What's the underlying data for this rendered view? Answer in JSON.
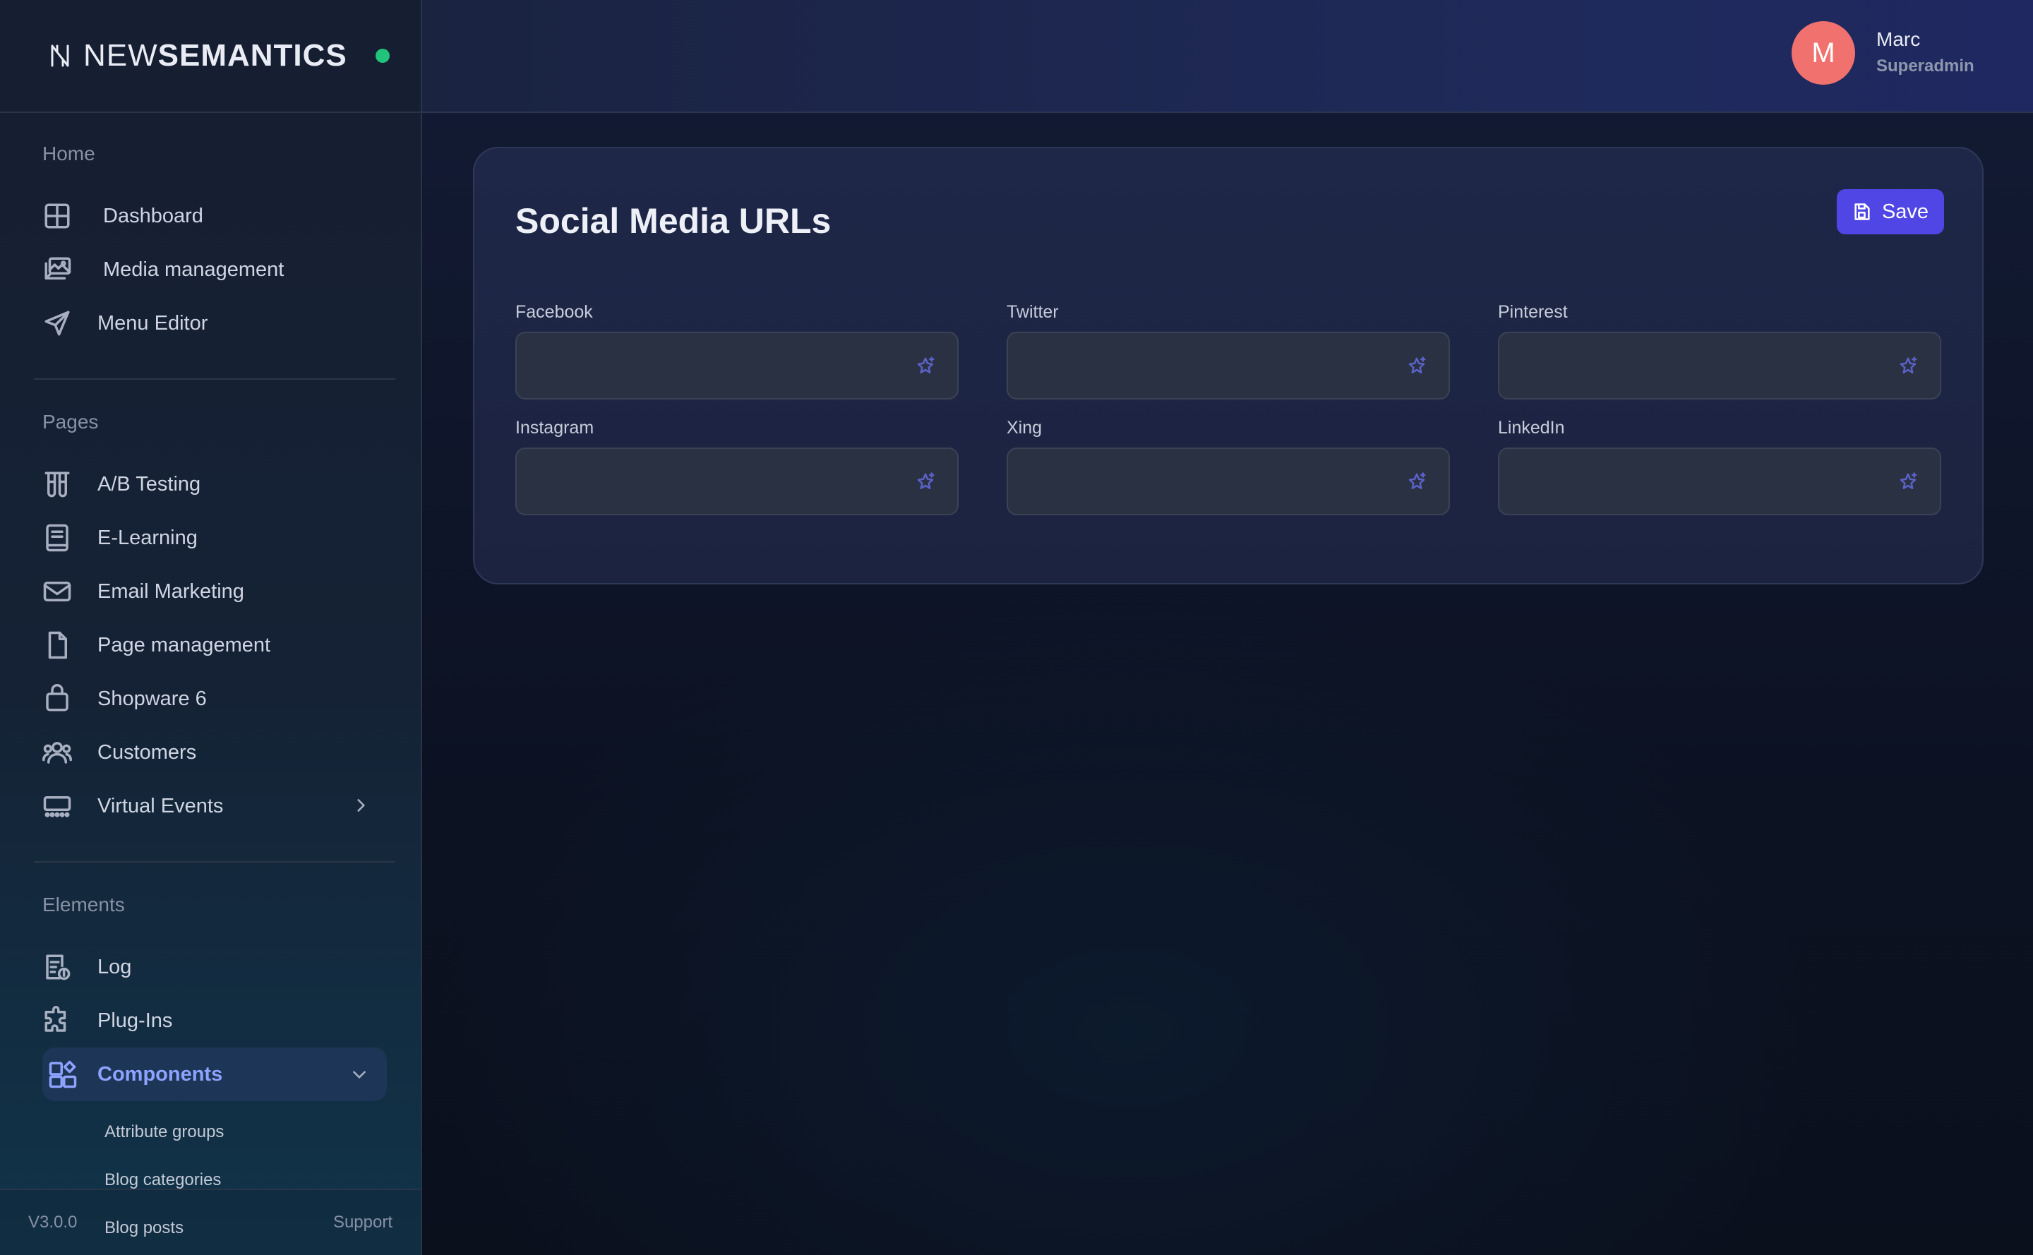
{
  "brand": {
    "prefix": "NEW",
    "suffix": "SEMANTICS"
  },
  "user": {
    "initial": "M",
    "name": "Marc",
    "role": "Superadmin"
  },
  "sidebar": {
    "sections": [
      {
        "title": "Home"
      },
      {
        "title": "Pages"
      },
      {
        "title": "Elements"
      }
    ],
    "home_items": [
      {
        "label": "Dashboard",
        "icon": "grid-icon"
      },
      {
        "label": "Media management",
        "icon": "images-icon"
      },
      {
        "label": "Menu Editor",
        "icon": "send-icon"
      }
    ],
    "pages_items": [
      {
        "label": "A/B Testing",
        "icon": "test-tubes-icon"
      },
      {
        "label": "E-Learning",
        "icon": "book-icon"
      },
      {
        "label": "Email Marketing",
        "icon": "mail-icon"
      },
      {
        "label": "Page management",
        "icon": "file-icon"
      },
      {
        "label": "Shopware 6",
        "icon": "shopping-bag-icon"
      },
      {
        "label": "Customers",
        "icon": "users-icon"
      },
      {
        "label": "Virtual Events",
        "icon": "presentation-icon"
      }
    ],
    "elements_items": [
      {
        "label": "Log",
        "icon": "file-info-icon"
      },
      {
        "label": "Plug-Ins",
        "icon": "puzzle-icon"
      },
      {
        "label": "Components",
        "icon": "components-icon"
      }
    ],
    "sub_items": [
      {
        "label": "Attribute groups"
      },
      {
        "label": "Blog categories"
      },
      {
        "label": "Blog posts"
      }
    ],
    "footer": {
      "version": "V3.0.0",
      "support": "Support"
    }
  },
  "card": {
    "title": "Social Media URLs",
    "save_label": "Save",
    "fields": [
      {
        "label": "Facebook",
        "value": ""
      },
      {
        "label": "Twitter",
        "value": ""
      },
      {
        "label": "Pinterest",
        "value": ""
      },
      {
        "label": "Instagram",
        "value": ""
      },
      {
        "label": "Xing",
        "value": ""
      },
      {
        "label": "LinkedIn",
        "value": ""
      }
    ]
  },
  "colors": {
    "accent": "#4f46e5",
    "active_text": "#8ea2ff",
    "status_online": "#22c37a",
    "avatar": "#f1716f"
  }
}
